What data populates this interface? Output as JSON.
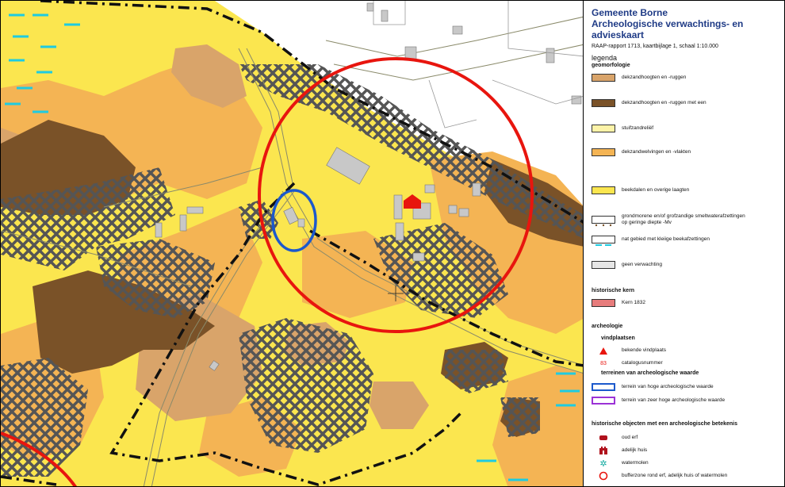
{
  "map": {
    "crosshair": "crosshair-marker",
    "buffer_circle_color": "#e8150e",
    "blue_circle_color": "#1c59cc"
  },
  "legend": {
    "title_line1": "Gemeente Borne",
    "title_line2": "Archeologische verwachtings- en advieskaart",
    "subtitle": "RAAP-rapport 1713, kaartbijlage 1, schaal 1:10.000",
    "legend_heading": "legenda",
    "geomorfologie": {
      "heading": "geomorfologie",
      "items": [
        {
          "label": "dekzandhoogten en -ruggen",
          "color": "#d9a46a"
        },
        {
          "label": "dekzandhoogten en -ruggen met een",
          "color": "#7a5228"
        },
        {
          "label": "stuifzandreliëf",
          "color": "#fdf3a8"
        },
        {
          "label": "dekzandwelvingen en -vlakten",
          "color": "#f4b454"
        },
        {
          "label": "beekdalen en overige laagten",
          "color": "#fbe64f"
        },
        {
          "label": "grondmorene en/of grofzandige smeltwaterafzettingen",
          "label2": "op geringe diepte -Mv",
          "color": "#ffffff"
        },
        {
          "label": "nat gebied met kleiige beekafzettingen",
          "color": "#ffffff"
        },
        {
          "label": "geen verwachting",
          "color": "#e6e6e6"
        }
      ]
    },
    "historische_kern": {
      "heading": "historische kern",
      "items": [
        {
          "label": "Kern 1832",
          "color": "#e77c7c"
        }
      ]
    },
    "archeologie": {
      "heading": "archeologie",
      "vindplaatsen": "vindplaatsen",
      "bekende": "bekende vindplaats",
      "catalogus_num": "83",
      "catalogus": "catalogusnummer",
      "terreinen": "terreinen van archeologische waarde",
      "hoge": "terrein van hoge archeologische waarde",
      "zeer_hoge": "terrein van zeer hoge archeologische waarde"
    },
    "historische_objecten": {
      "heading": "historische objecten met een archeologische betekenis",
      "oud_erf": "oud erf",
      "adelijk": "adelijk huis",
      "watermolen": "watermolen",
      "bufferzone": "bufferzone rond erf, adelijk huis of watermolen"
    }
  }
}
